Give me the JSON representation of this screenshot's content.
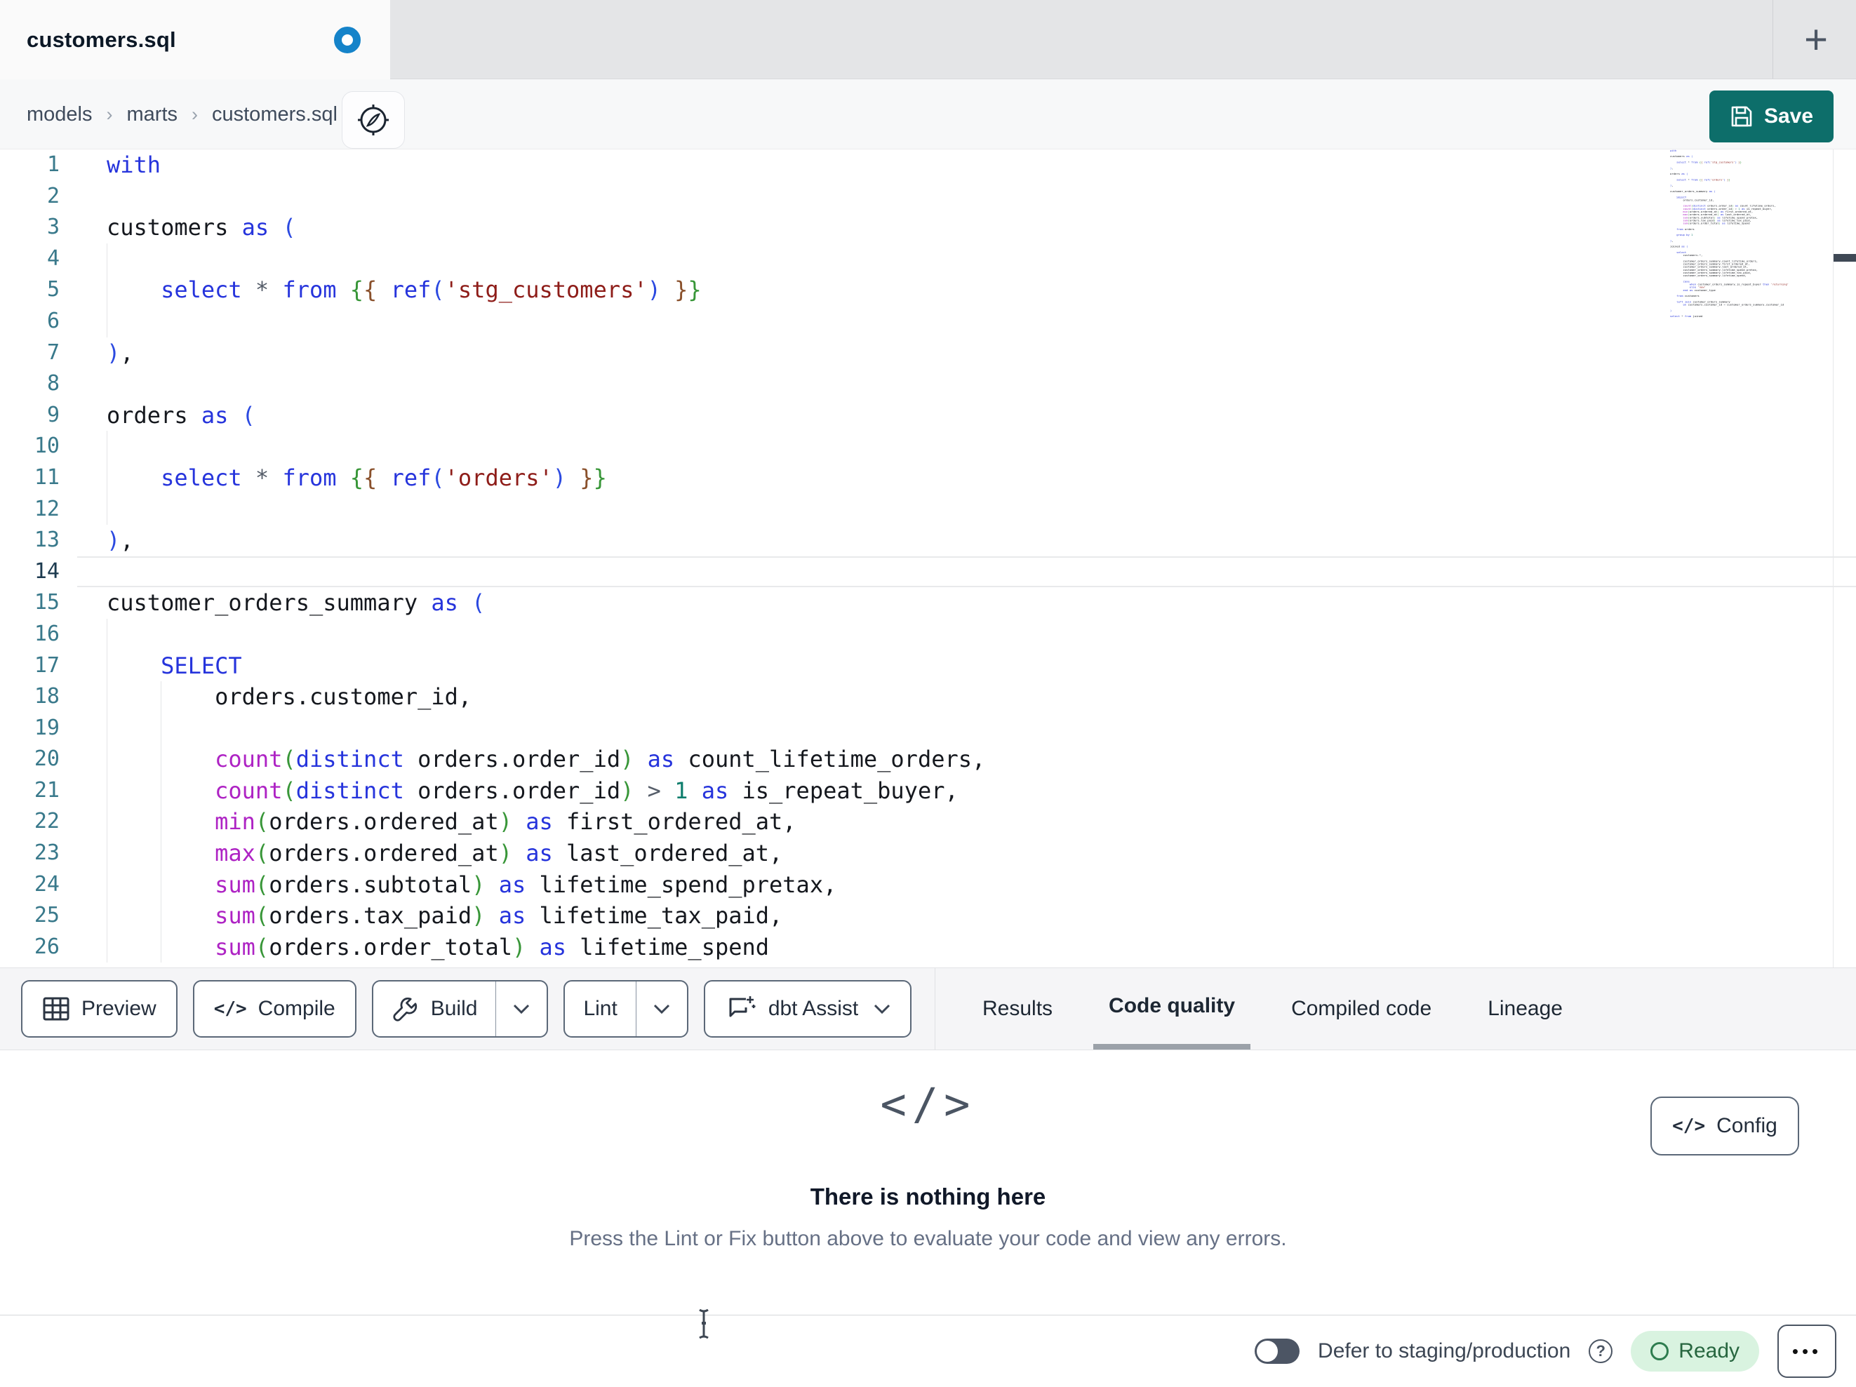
{
  "tab_bar": {
    "active_tab": "customers.sql",
    "has_unsaved_changes": true
  },
  "breadcrumb": {
    "items": [
      "models",
      "marts",
      "customers.sql"
    ]
  },
  "actions": {
    "save_label": "Save"
  },
  "glyphs": {
    "plus": "+",
    "chevron_right": "›",
    "code_brackets": "</>",
    "question_mark": "?",
    "ellipsis": "•••"
  },
  "icons": {
    "unsaved_indicator": "dot-ring",
    "breadcrumb_assist": "compass",
    "save": "floppy-disk",
    "preview": "table-grid",
    "compile": "code-brackets",
    "build": "wrench",
    "dbt_assist": "chat-plus",
    "empty_state": "code-brackets",
    "config": "code-brackets",
    "help": "question-circle",
    "more_menu": "ellipsis",
    "new_tab": "plus",
    "mouse_pointer": "i-beam-cursor"
  },
  "toolbar": {
    "buttons": [
      {
        "label": "Preview",
        "icon": "table-grid",
        "has_dropdown": false
      },
      {
        "label": "Compile",
        "icon": "code-brackets",
        "has_dropdown": false
      },
      {
        "label": "Build",
        "icon": "wrench",
        "has_dropdown": true
      },
      {
        "label": "Lint",
        "icon": null,
        "has_dropdown": true
      },
      {
        "label": "dbt Assist",
        "icon": "chat-plus",
        "has_dropdown": true
      }
    ],
    "tabs": [
      {
        "label": "Results",
        "active": false
      },
      {
        "label": "Code quality",
        "active": true
      },
      {
        "label": "Compiled code",
        "active": false
      },
      {
        "label": "Lineage",
        "active": false
      }
    ]
  },
  "results_panel": {
    "empty_title": "There is nothing here",
    "empty_description": "Press the Lint or Fix button above to evaluate your code and view any errors.",
    "config_label": "Config"
  },
  "status_bar": {
    "defer_label": "Defer to staging/production",
    "defer_toggle_on": false,
    "ready_label": "Ready"
  },
  "colors": {
    "save_button": "#0d6e6a",
    "unsaved_dot": "#1583c9",
    "ready_badge_bg": "#d9f3e0",
    "ready_badge_text": "#27663f",
    "ready_badge_icon": "#2e7d4f",
    "active_tab_underline": "#9ba1a9"
  },
  "code": {
    "language": "sql",
    "visible_line_count": 26,
    "active_line": 14,
    "syntax_colors": {
      "keyword": "#2634dc",
      "function_name": "#ae23c4",
      "string": "#8e1d19",
      "number": "#0d7d6c",
      "bracket_level1": "#2b49e0",
      "bracket_level2": "#389638",
      "bracket_level3": "#8a512c",
      "operator": "#555d69",
      "plain": "#15181e",
      "line_number": "#39798b",
      "active_line_number": "#1c3a4f"
    },
    "indent_guides": {
      "4": 1,
      "5": 1,
      "6": 1,
      "10": 1,
      "11": 1,
      "12": 1,
      "16": 1,
      "17": 1,
      "18": 2,
      "19": 2,
      "20": 2,
      "21": 2,
      "22": 2,
      "23": 2,
      "24": 2,
      "25": 2,
      "26": 2
    },
    "lines": [
      [
        [
          "with",
          "k"
        ]
      ],
      [],
      [
        [
          "customers ",
          "p"
        ],
        [
          "as",
          "k"
        ],
        [
          " ",
          "p"
        ],
        [
          "(",
          "u"
        ]
      ],
      [],
      [
        [
          "    ",
          "p"
        ],
        [
          "select",
          "k"
        ],
        [
          " ",
          "p"
        ],
        [
          "*",
          "o"
        ],
        [
          " ",
          "p"
        ],
        [
          "from",
          "k"
        ],
        [
          " ",
          "p"
        ],
        [
          "{",
          "g"
        ],
        [
          "{",
          "b"
        ],
        [
          " ",
          "p"
        ],
        [
          "ref",
          "k"
        ],
        [
          "(",
          "u"
        ],
        [
          "'stg_customers'",
          "s"
        ],
        [
          ")",
          "u"
        ],
        [
          " ",
          "p"
        ],
        [
          "}",
          "b"
        ],
        [
          "}",
          "g"
        ]
      ],
      [],
      [
        [
          ")",
          "u"
        ],
        [
          ",",
          "p"
        ]
      ],
      [],
      [
        [
          "orders ",
          "p"
        ],
        [
          "as",
          "k"
        ],
        [
          " ",
          "p"
        ],
        [
          "(",
          "u"
        ]
      ],
      [],
      [
        [
          "    ",
          "p"
        ],
        [
          "select",
          "k"
        ],
        [
          " ",
          "p"
        ],
        [
          "*",
          "o"
        ],
        [
          " ",
          "p"
        ],
        [
          "from",
          "k"
        ],
        [
          " ",
          "p"
        ],
        [
          "{",
          "g"
        ],
        [
          "{",
          "b"
        ],
        [
          " ",
          "p"
        ],
        [
          "ref",
          "k"
        ],
        [
          "(",
          "u"
        ],
        [
          "'orders'",
          "s"
        ],
        [
          ")",
          "u"
        ],
        [
          " ",
          "p"
        ],
        [
          "}",
          "b"
        ],
        [
          "}",
          "g"
        ]
      ],
      [],
      [
        [
          ")",
          "u"
        ],
        [
          ",",
          "p"
        ]
      ],
      [],
      [
        [
          "customer_orders_summary ",
          "p"
        ],
        [
          "as",
          "k"
        ],
        [
          " ",
          "p"
        ],
        [
          "(",
          "u"
        ]
      ],
      [],
      [
        [
          "    ",
          "p"
        ],
        [
          "SELECT",
          "k"
        ]
      ],
      [
        [
          "        orders.customer_id,",
          "p"
        ]
      ],
      [],
      [
        [
          "        ",
          "p"
        ],
        [
          "count",
          "f"
        ],
        [
          "(",
          "g"
        ],
        [
          "distinct",
          "k"
        ],
        [
          " orders.order_id",
          "p"
        ],
        [
          ")",
          "g"
        ],
        [
          " ",
          "p"
        ],
        [
          "as",
          "k"
        ],
        [
          " count_lifetime_orders,",
          "p"
        ]
      ],
      [
        [
          "        ",
          "p"
        ],
        [
          "count",
          "f"
        ],
        [
          "(",
          "g"
        ],
        [
          "distinct",
          "k"
        ],
        [
          " orders.order_id",
          "p"
        ],
        [
          ")",
          "g"
        ],
        [
          " ",
          "p"
        ],
        [
          ">",
          "o"
        ],
        [
          " ",
          "p"
        ],
        [
          "1",
          "n"
        ],
        [
          " ",
          "p"
        ],
        [
          "as",
          "k"
        ],
        [
          " is_repeat_buyer,",
          "p"
        ]
      ],
      [
        [
          "        ",
          "p"
        ],
        [
          "min",
          "f"
        ],
        [
          "(",
          "g"
        ],
        [
          "orders.ordered_at",
          "p"
        ],
        [
          ")",
          "g"
        ],
        [
          " ",
          "p"
        ],
        [
          "as",
          "k"
        ],
        [
          " first_ordered_at,",
          "p"
        ]
      ],
      [
        [
          "        ",
          "p"
        ],
        [
          "max",
          "f"
        ],
        [
          "(",
          "g"
        ],
        [
          "orders.ordered_at",
          "p"
        ],
        [
          ")",
          "g"
        ],
        [
          " ",
          "p"
        ],
        [
          "as",
          "k"
        ],
        [
          " last_ordered_at,",
          "p"
        ]
      ],
      [
        [
          "        ",
          "p"
        ],
        [
          "sum",
          "f"
        ],
        [
          "(",
          "g"
        ],
        [
          "orders.subtotal",
          "p"
        ],
        [
          ")",
          "g"
        ],
        [
          " ",
          "p"
        ],
        [
          "as",
          "k"
        ],
        [
          " lifetime_spend_pretax,",
          "p"
        ]
      ],
      [
        [
          "        ",
          "p"
        ],
        [
          "sum",
          "f"
        ],
        [
          "(",
          "g"
        ],
        [
          "orders.tax_paid",
          "p"
        ],
        [
          ")",
          "g"
        ],
        [
          " ",
          "p"
        ],
        [
          "as",
          "k"
        ],
        [
          " lifetime_tax_paid,",
          "p"
        ]
      ],
      [
        [
          "        ",
          "p"
        ],
        [
          "sum",
          "f"
        ],
        [
          "(",
          "g"
        ],
        [
          "orders.order_total",
          "p"
        ],
        [
          ")",
          "g"
        ],
        [
          " ",
          "p"
        ],
        [
          "as",
          "k"
        ],
        [
          " lifetime_spend",
          "p"
        ]
      ],
      [],
      [
        [
          "    ",
          "p"
        ],
        [
          "from",
          "k"
        ],
        [
          " orders",
          "p"
        ]
      ],
      [],
      [
        [
          "    ",
          "p"
        ],
        [
          "group by",
          "k"
        ],
        [
          " ",
          "p"
        ],
        [
          "1",
          "n"
        ]
      ],
      [],
      [
        [
          ")",
          "u"
        ],
        [
          ",",
          "p"
        ]
      ],
      [],
      [
        [
          "joined ",
          "p"
        ],
        [
          "as",
          "k"
        ],
        [
          " ",
          "p"
        ],
        [
          "(",
          "u"
        ]
      ],
      [],
      [
        [
          "    ",
          "p"
        ],
        [
          "select",
          "k"
        ]
      ],
      [
        [
          "        customers.",
          "p"
        ],
        [
          "*",
          "o"
        ],
        [
          ",",
          "p"
        ]
      ],
      [],
      [
        [
          "        customer_orders_summary.count_lifetime_orders,",
          "p"
        ]
      ],
      [
        [
          "        customer_orders_summary.first_ordered_at,",
          "p"
        ]
      ],
      [
        [
          "        customer_orders_summary.last_ordered_at,",
          "p"
        ]
      ],
      [
        [
          "        customer_orders_summary.lifetime_spend_pretax,",
          "p"
        ]
      ],
      [
        [
          "        customer_orders_summary.lifetime_tax_paid,",
          "p"
        ]
      ],
      [
        [
          "        customer_orders_summary.lifetime_spend,",
          "p"
        ]
      ],
      [],
      [
        [
          "        ",
          "p"
        ],
        [
          "case",
          "k"
        ]
      ],
      [
        [
          "            ",
          "p"
        ],
        [
          "when",
          "k"
        ],
        [
          " customer_orders_summary.is_repeat_buyer ",
          "p"
        ],
        [
          "then",
          "k"
        ],
        [
          " ",
          "p"
        ],
        [
          "'returning'",
          "s"
        ]
      ],
      [
        [
          "            ",
          "p"
        ],
        [
          "else",
          "k"
        ],
        [
          " ",
          "p"
        ],
        [
          "'new'",
          "s"
        ]
      ],
      [
        [
          "        ",
          "p"
        ],
        [
          "end",
          "k"
        ],
        [
          " ",
          "p"
        ],
        [
          "as",
          "k"
        ],
        [
          " customer_type",
          "p"
        ]
      ],
      [],
      [
        [
          "    ",
          "p"
        ],
        [
          "from",
          "k"
        ],
        [
          " customers",
          "p"
        ]
      ],
      [],
      [
        [
          "    ",
          "p"
        ],
        [
          "left join",
          "k"
        ],
        [
          " customer_orders_summary",
          "p"
        ]
      ],
      [
        [
          "        ",
          "p"
        ],
        [
          "on",
          "k"
        ],
        [
          " customers.customer_id ",
          "p"
        ],
        [
          "=",
          "o"
        ],
        [
          " customer_orders_summary.customer_id",
          "p"
        ]
      ],
      [],
      [
        [
          ")",
          "u"
        ]
      ],
      [],
      [
        [
          "select",
          "k"
        ],
        [
          " ",
          "p"
        ],
        [
          "*",
          "o"
        ],
        [
          " ",
          "p"
        ],
        [
          "from",
          "k"
        ],
        [
          " joined",
          "p"
        ]
      ]
    ]
  }
}
